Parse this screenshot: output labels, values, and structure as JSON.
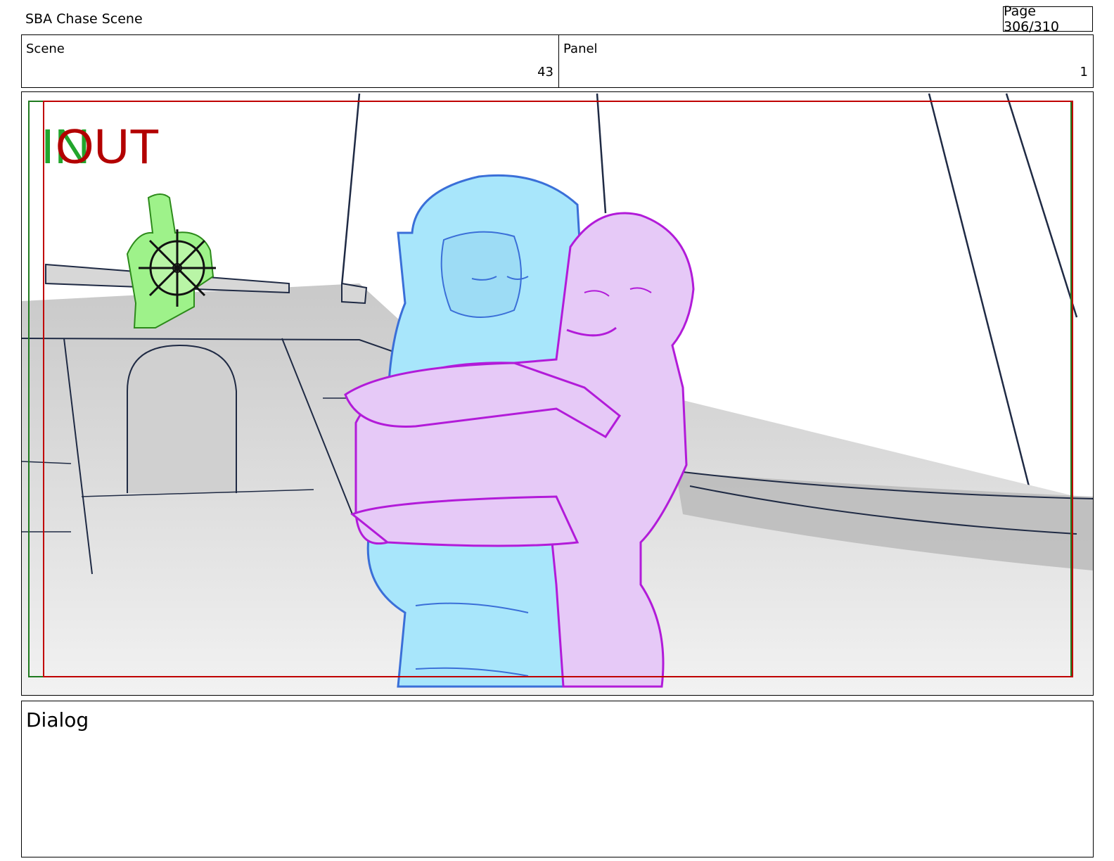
{
  "header": {
    "title": "SBA Chase Scene",
    "page": "Page 306/310"
  },
  "info": {
    "scene_label": "Scene",
    "scene_value": "43",
    "panel_label": "Panel",
    "panel_value": "1"
  },
  "panel_image": {
    "in_marker": "IN",
    "out_marker": "OUT",
    "colors": {
      "in_marker": "#22a52c",
      "out_marker": "#b30000",
      "safe_area_green": "#1f7a1f",
      "safe_area_red": "#c00000",
      "character_left": "#a8e6fb",
      "character_left_line": "#3a6fd8",
      "character_right": "#e6c9f7",
      "character_right_line": "#b21bd9",
      "helmsman": "#9ef28a",
      "ship": "#cfcfcf",
      "lines": "#1f2a44"
    }
  },
  "dialog": {
    "label": "Dialog",
    "text": ""
  }
}
